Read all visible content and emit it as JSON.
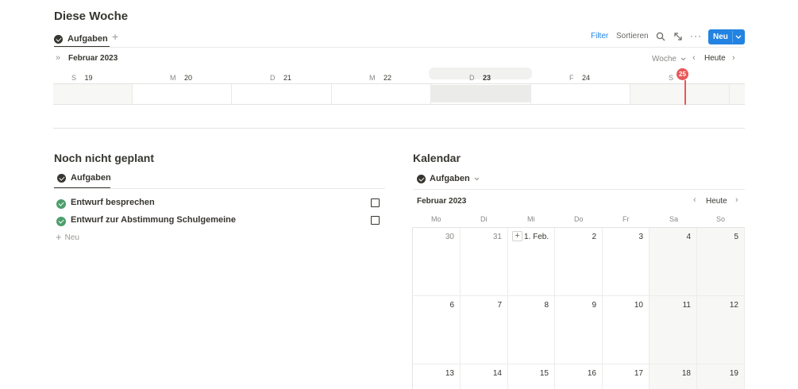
{
  "top": {
    "title": "Diese Woche",
    "tab_label": "Aufgaben",
    "toolbar": {
      "filter": "Filter",
      "sort": "Sortieren",
      "new_button": "Neu"
    },
    "timeline": {
      "month": "Februar 2023",
      "range_select": "Woche",
      "today": "Heute",
      "days": [
        {
          "wd": "S",
          "num": "19"
        },
        {
          "wd": "M",
          "num": "20"
        },
        {
          "wd": "D",
          "num": "21"
        },
        {
          "wd": "M",
          "num": "22"
        },
        {
          "wd": "D",
          "num": "23"
        },
        {
          "wd": "F",
          "num": "24"
        },
        {
          "wd": "S",
          "num": "25"
        }
      ],
      "today_color": "#eb5757"
    }
  },
  "left": {
    "title": "Noch nicht geplant",
    "tab_label": "Aufgaben",
    "items": [
      {
        "label": "Entwurf besprechen",
        "checked": false
      },
      {
        "label": "Entwurf zur Abstimmung Schulgemeine",
        "checked": false
      }
    ],
    "add_label": "Neu"
  },
  "calendar": {
    "title": "Kalendar",
    "view_label": "Aufgaben",
    "month": "Februar 2023",
    "today": "Heute",
    "weekdays": [
      "Mo",
      "Di",
      "Mi",
      "Do",
      "Fr",
      "Sa",
      "So"
    ],
    "weeks": [
      [
        "30",
        "31",
        "1. Feb.",
        "2",
        "3",
        "4",
        "5"
      ],
      [
        "6",
        "7",
        "8",
        "9",
        "10",
        "11",
        "12"
      ],
      [
        "13",
        "14",
        "15",
        "16",
        "17",
        "18",
        "19"
      ]
    ]
  },
  "colors": {
    "accent": "#2383e2",
    "done": "#4d9e6c"
  }
}
